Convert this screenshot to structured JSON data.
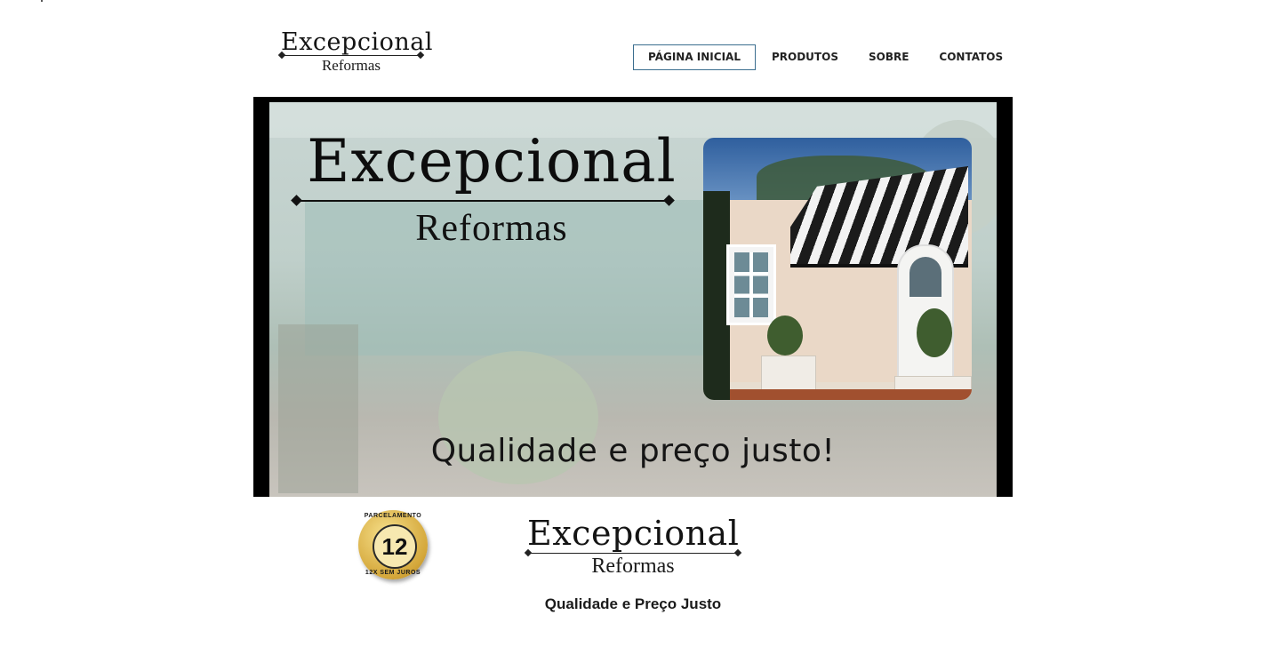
{
  "header": {
    "logo": {
      "word": "Excepcional",
      "sub": "Reformas"
    },
    "nav": [
      {
        "label": "PÁGINA INICIAL",
        "active": true
      },
      {
        "label": "PRODUTOS",
        "active": false
      },
      {
        "label": "SOBRE",
        "active": false
      },
      {
        "label": "CONTATOS",
        "active": false
      }
    ]
  },
  "hero": {
    "logo": {
      "word": "Excepcional",
      "sub": "Reformas"
    },
    "tagline": "Qualidade e preço justo!"
  },
  "badge": {
    "number": "12",
    "top_text": "PARCELAMENTO",
    "bottom_text": "12X SEM JUROS"
  },
  "footer_logo": {
    "word": "Excepcional",
    "sub": "Reformas"
  },
  "tagline": "Qualidade e Preço Justo",
  "colors": {
    "accent": "#3b6e8f",
    "text": "#1b1b1b",
    "gold": "#d4a73a"
  }
}
